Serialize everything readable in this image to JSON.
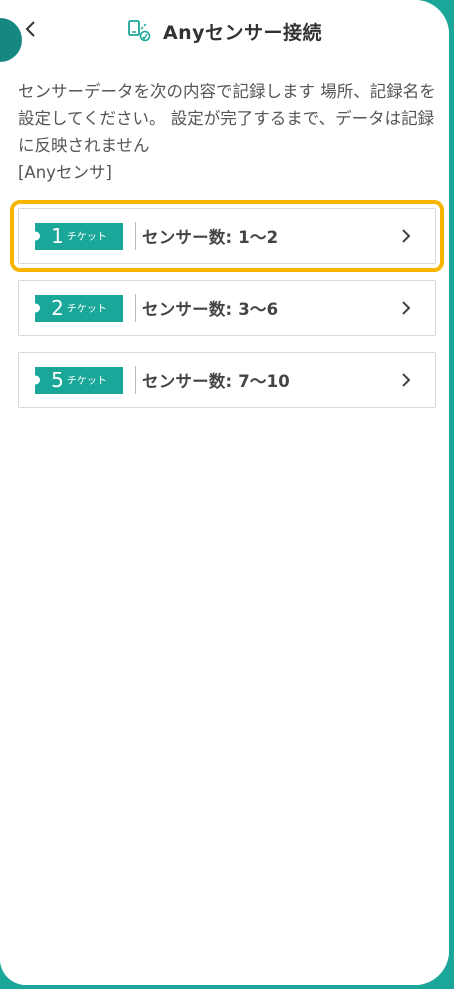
{
  "header": {
    "title": "Anyセンサー接続",
    "back_icon": "chevron-left-icon",
    "title_icon": "sensor-touch-icon"
  },
  "description": {
    "text": "センサーデータを次の内容で記録します 場所、記録名を設定してください。 設定が完了するまで、データは記録に反映されません",
    "sensor_name": "[Anyセンサ]"
  },
  "options": [
    {
      "ticket_count": "1",
      "ticket_unit": "チケット",
      "label": "センサー数: 1〜2"
    },
    {
      "ticket_count": "2",
      "ticket_unit": "チケット",
      "label": "センサー数: 3〜6"
    },
    {
      "ticket_count": "5",
      "ticket_unit": "チケット",
      "label": "センサー数: 7〜10"
    }
  ],
  "colors": {
    "accent": "#1aa79a",
    "highlight": "#f7b500"
  }
}
